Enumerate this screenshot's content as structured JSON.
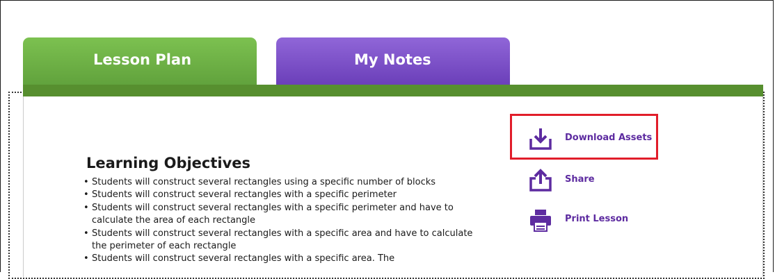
{
  "tabs": [
    {
      "label": "Lesson Plan",
      "active": true
    },
    {
      "label": "My Notes",
      "active": false
    }
  ],
  "colors": {
    "lesson_tab": "#6bab44",
    "notes_tab": "#7a4fc9",
    "action_text": "#5d2ba0",
    "highlight": "#e11d2a"
  },
  "content": {
    "heading": "Learning Objectives",
    "objectives": [
      "Students will construct several rectangles using a specific number of blocks",
      "Students will construct several rectangles with a specific perimeter",
      "Students will construct several rectangles with a specific perimeter and have to calculate the area of each rectangle",
      "Students will construct several rectangles with a specific area and have to calculate the perimeter of each rectangle",
      "Students will construct several rectangles with a specific area. The"
    ]
  },
  "actions": [
    {
      "label": "Download Assets",
      "icon": "download-icon"
    },
    {
      "label": "Share",
      "icon": "share-icon"
    },
    {
      "label": "Print Lesson",
      "icon": "print-icon"
    }
  ]
}
